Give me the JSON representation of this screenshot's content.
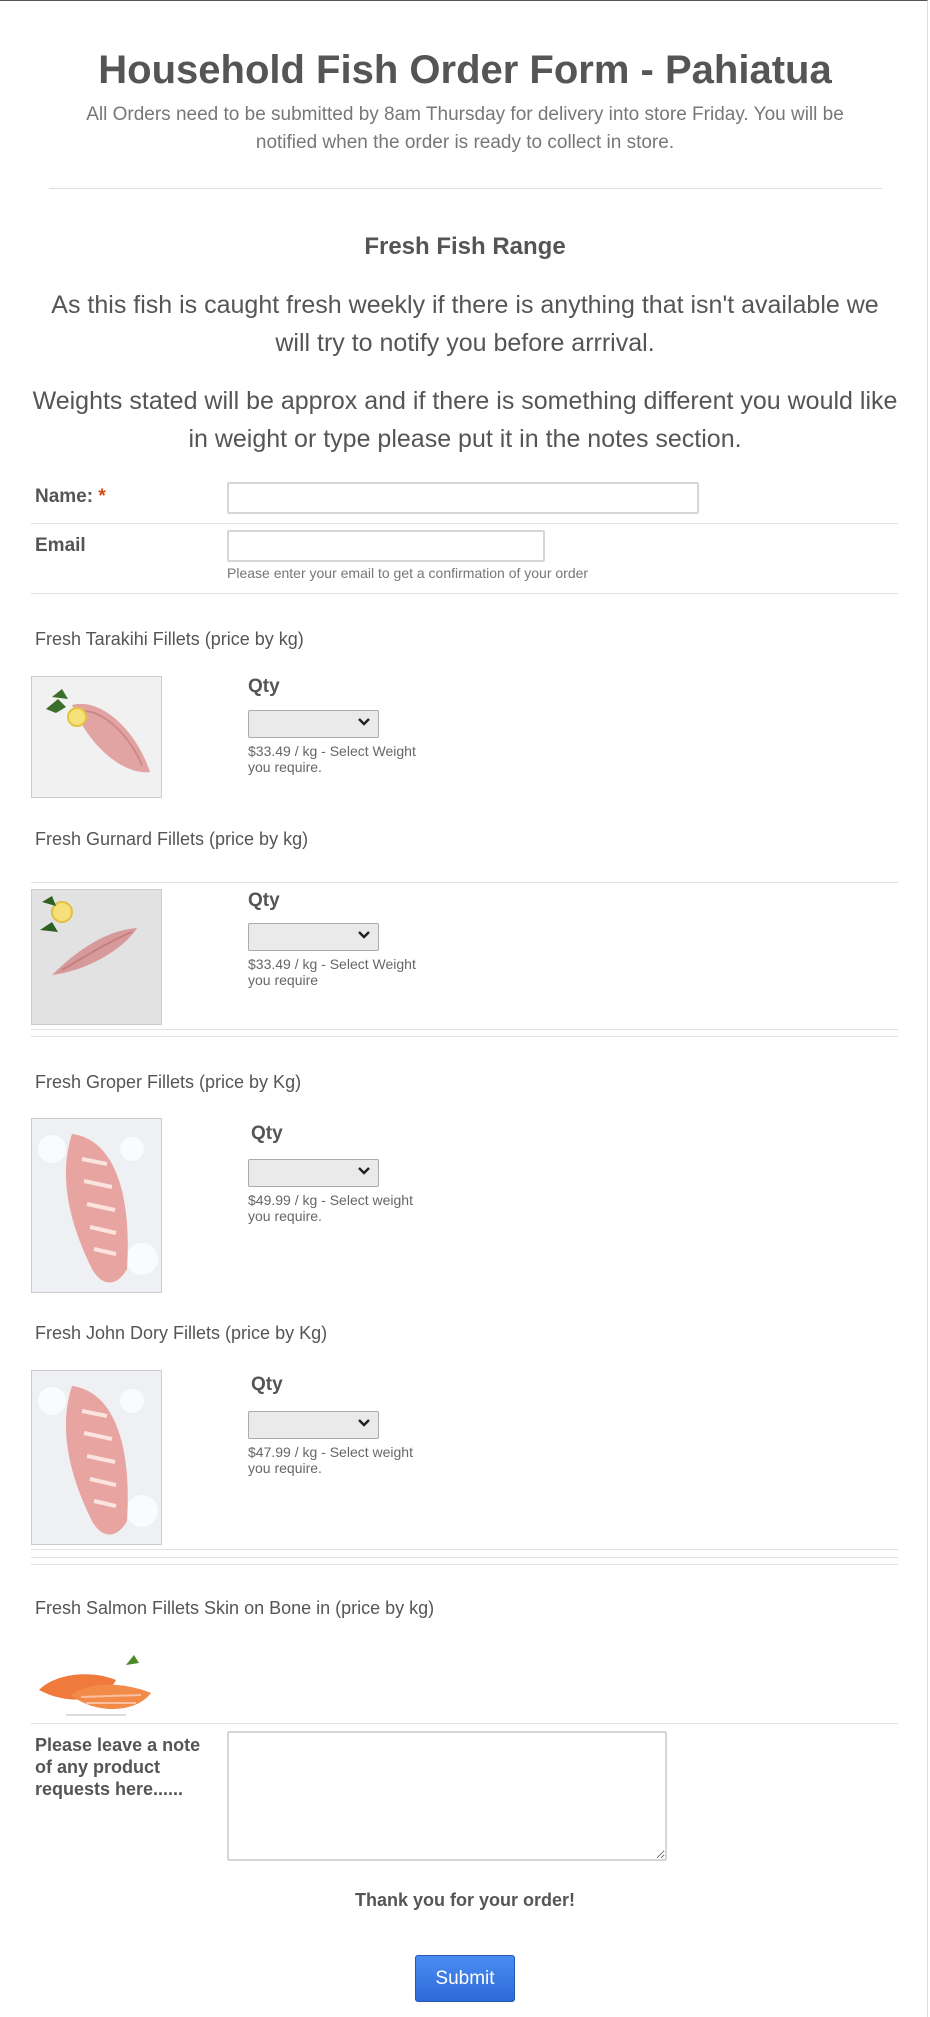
{
  "form": {
    "title": "Household Fish Order Form - Pahiatua",
    "subtitle": "All Orders need to be submitted by 8am Thursday for delivery into store Friday. You will be notified when the order is ready to collect in store.",
    "section_title": "Fresh Fish Range",
    "paragraph_1": "As this fish is caught fresh weekly if there is anything that isn't available we will try to notify you before arrrival.",
    "paragraph_2": "Weights stated will be approx and if there is something different you would like in weight or type please put it in the notes section."
  },
  "fields": {
    "name_label": "Name:",
    "required_mark": "*",
    "name_value": "",
    "email_label": "Email",
    "email_value": "",
    "email_sublabel": "Please enter your email to get a confirmation of your order"
  },
  "products": [
    {
      "title": "Fresh Tarakihi Fillets (price by kg)",
      "image": "tarakihi-fillet-photo",
      "qty_label": "Qty",
      "selected": "",
      "price_note": "$33.49 / kg - Select Weight you require."
    },
    {
      "title": "Fresh Gurnard Fillets (price by kg)",
      "image": "gurnard-fillet-photo",
      "qty_label": "Qty",
      "selected": "",
      "price_note": "$33.49 / kg - Select Weight you require"
    },
    {
      "title": "Fresh Groper Fillets (price by Kg)",
      "image": "groper-fillet-photo",
      "qty_label": "Qty",
      "selected": "",
      "price_note": "$49.99 / kg - Select weight you require."
    },
    {
      "title": "Fresh John Dory Fillets (price by Kg)",
      "image": "john-dory-fillet-photo",
      "qty_label": "Qty",
      "selected": "",
      "price_note": "$47.99 / kg - Select weight you require."
    },
    {
      "title": "Fresh Salmon Fillets Skin on Bone in (price by kg)",
      "image": "salmon-fillet-photo"
    }
  ],
  "notes": {
    "label": "Please leave a note of any product requests here......",
    "value": ""
  },
  "footer": {
    "thanks": "Thank you for your order!",
    "submit_label": "Submit"
  },
  "icons": {
    "select_arrow": "chevron-down-icon"
  },
  "colors": {
    "required": "#d54a0f",
    "submit": "#2e6ad9",
    "text": "#555555"
  }
}
